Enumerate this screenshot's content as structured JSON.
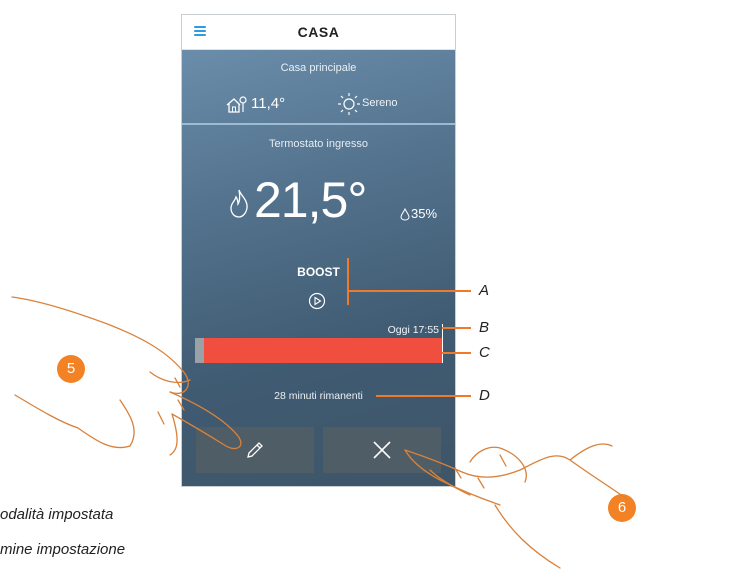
{
  "app": {
    "title": "CASA",
    "home_name": "Casa principale"
  },
  "weather": {
    "outdoor_temp": "11,4°",
    "condition": "Sereno",
    "house_icon": "house-sensor-icon",
    "condition_icon": "sun-icon"
  },
  "thermostat": {
    "name": "Termostato ingresso",
    "temperature": "21,5°",
    "humidity": "35%",
    "mode": "BOOST",
    "end_time": "Oggi 17:55",
    "remaining": "28 minuti rimanenti",
    "bar_fill_fraction": 1.0
  },
  "buttons": {
    "edit_icon": "pencil-icon",
    "cancel_icon": "close-icon"
  },
  "annotations": {
    "a": "A",
    "b": "B",
    "c": "C",
    "d": "D",
    "step5": "5",
    "step6": "6"
  },
  "legend": {
    "line1": "odalità impostata",
    "line2": "mine impostazione"
  },
  "colors": {
    "accent": "#2e9be0",
    "boost_bar": "#f04e3e",
    "annotation": "#f07a2a"
  }
}
